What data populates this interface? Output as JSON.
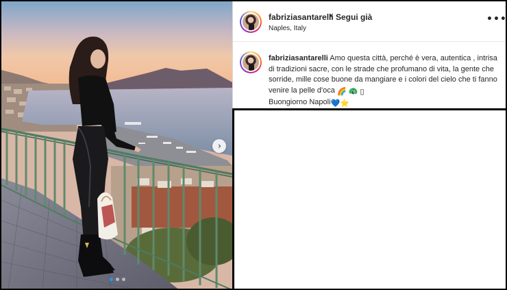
{
  "post": {
    "username": "fabriziasantarelli",
    "separator": "•",
    "follow_label": "Segui già",
    "location": "Naples, Italy",
    "more_label": "•••"
  },
  "caption": {
    "username": "fabriziasantarelli",
    "text": "Amo questa città, perché è vera, autentica , intrisa di tradizioni sacre, con le strade che profumano di vita, la gente che sorride, mille cose buone da mangiare e i colori del cielo che ti fanno venire la pelle d'oca",
    "emojis": "🌈 🦚 ▯",
    "line2": "Buongiorno Napoli",
    "line2_emojis": "💙⭐"
  },
  "carousel": {
    "next_icon": "chevron-right-icon",
    "dot_count": 3,
    "active_index": 0
  },
  "colors": {
    "dot_active": "#1a9bf0",
    "text": "#262626"
  }
}
